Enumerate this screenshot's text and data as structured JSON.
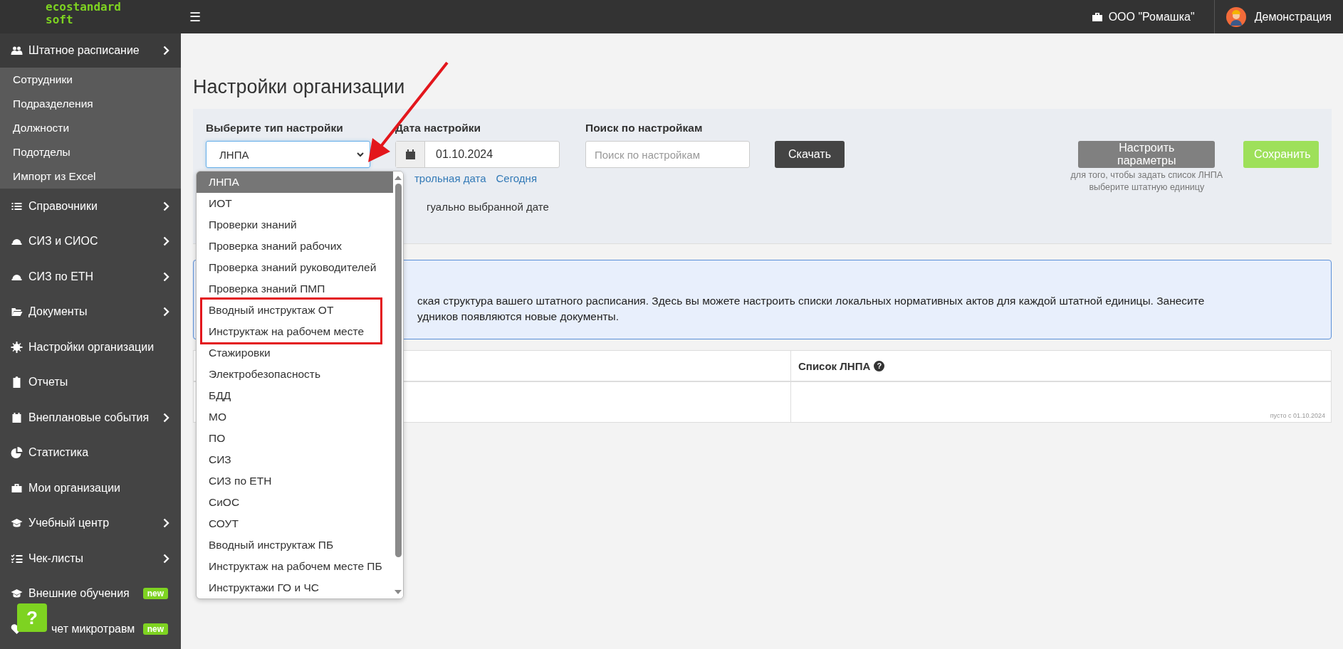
{
  "topbar": {
    "logo": [
      "ecostandard",
      "soft"
    ],
    "menu_glyph": "☰",
    "organization": "ООО \"Ромашка\"",
    "user": "Демонстрация"
  },
  "sidebar": {
    "items": [
      {
        "label": "Штатное расписание",
        "expanded": true,
        "has_submenu": true,
        "children": [
          {
            "label": "Сотрудники"
          },
          {
            "label": "Подразделения"
          },
          {
            "label": "Должности"
          },
          {
            "label": "Подотделы"
          },
          {
            "label": "Импорт из Excel"
          }
        ]
      },
      {
        "label": "Справочники",
        "expanded": false,
        "has_submenu": true
      },
      {
        "label": "СИЗ и СИОС",
        "expanded": false,
        "has_submenu": true
      },
      {
        "label": "СИЗ по ЕТН",
        "expanded": false,
        "has_submenu": true
      },
      {
        "label": "Документы",
        "expanded": false,
        "has_submenu": true
      },
      {
        "label": "Настройки организации",
        "expanded": false,
        "has_submenu": false
      },
      {
        "label": "Отчеты",
        "expanded": false,
        "has_submenu": false
      },
      {
        "label": "Внеплановые события",
        "expanded": false,
        "has_submenu": true
      },
      {
        "label": "Статистика",
        "expanded": false,
        "has_submenu": false
      },
      {
        "label": "Мои организации",
        "expanded": false,
        "has_submenu": false
      },
      {
        "label": "Учебный центр",
        "expanded": false,
        "has_submenu": true
      },
      {
        "label": "Чек-листы",
        "expanded": false,
        "has_submenu": true
      },
      {
        "label": "Внешние обучения",
        "expanded": false,
        "has_submenu": false,
        "badge": "new"
      },
      {
        "label": "чет микротравм",
        "expanded": false,
        "has_submenu": false,
        "badge": "new"
      }
    ],
    "help": "?"
  },
  "page": {
    "title": "Настройки организации"
  },
  "filters": {
    "type": {
      "label": "Выберите тип настройки",
      "value": "ЛНПА",
      "open": true,
      "options": [
        {
          "label": "ЛНПА",
          "selected": true,
          "highlighted": false
        },
        {
          "label": "ИОТ",
          "selected": false,
          "highlighted": false
        },
        {
          "label": "Проверки знаний",
          "selected": false,
          "highlighted": false
        },
        {
          "label": "Проверка знаний рабочих",
          "selected": false,
          "highlighted": false
        },
        {
          "label": "Проверка знаний руководителей",
          "selected": false,
          "highlighted": false
        },
        {
          "label": "Проверка знаний ПМП",
          "selected": false,
          "highlighted": false
        },
        {
          "label": "Вводный инструктаж ОТ",
          "selected": false,
          "highlighted": true
        },
        {
          "label": "Инструктаж на рабочем месте",
          "selected": false,
          "highlighted": true
        },
        {
          "label": "Стажировки",
          "selected": false,
          "highlighted": false
        },
        {
          "label": "Электробезопасность",
          "selected": false,
          "highlighted": false
        },
        {
          "label": "БДД",
          "selected": false,
          "highlighted": false
        },
        {
          "label": "МО",
          "selected": false,
          "highlighted": false
        },
        {
          "label": "ПО",
          "selected": false,
          "highlighted": false
        },
        {
          "label": "СИЗ",
          "selected": false,
          "highlighted": false
        },
        {
          "label": "СИЗ по ЕТН",
          "selected": false,
          "highlighted": false
        },
        {
          "label": "СиОС",
          "selected": false,
          "highlighted": false
        },
        {
          "label": "СОУТ",
          "selected": false,
          "highlighted": false
        },
        {
          "label": "Вводный инструктаж ПБ",
          "selected": false,
          "highlighted": false
        },
        {
          "label": "Инструктаж на рабочем месте ПБ",
          "selected": false,
          "highlighted": false
        },
        {
          "label": "Инструктажи ГО и ЧС",
          "selected": false,
          "highlighted": false
        }
      ]
    },
    "date": {
      "label": "Дата настройки",
      "value": "01.10.2024",
      "links": [
        "трольная дата",
        "Сегодня"
      ]
    },
    "search": {
      "label": "Поиск по настройкам",
      "placeholder": "Поиск по настройкам"
    },
    "download_button": "Скачать",
    "configure_button": {
      "label": "Настроить параметры",
      "disabled": true
    },
    "configure_hint": [
      "для того, чтобы задать список ЛНПА",
      "выберите штатную единицу"
    ],
    "save_button": "Сохранить",
    "checkbox_label": "гуально выбранной дате"
  },
  "info_lines": [
    "ская структура вашего штатного расписания. Здесь вы можете настроить списки локальных нормативных актов для каждой штатной единицы. Занесите",
    "удников появляются новые документы."
  ],
  "table": {
    "column_2": {
      "label": "Список ЛНПА",
      "help": "?"
    },
    "rows": [
      {
        "note": "пусто с 01.10.2024"
      }
    ]
  },
  "arrow_annotation": true
}
